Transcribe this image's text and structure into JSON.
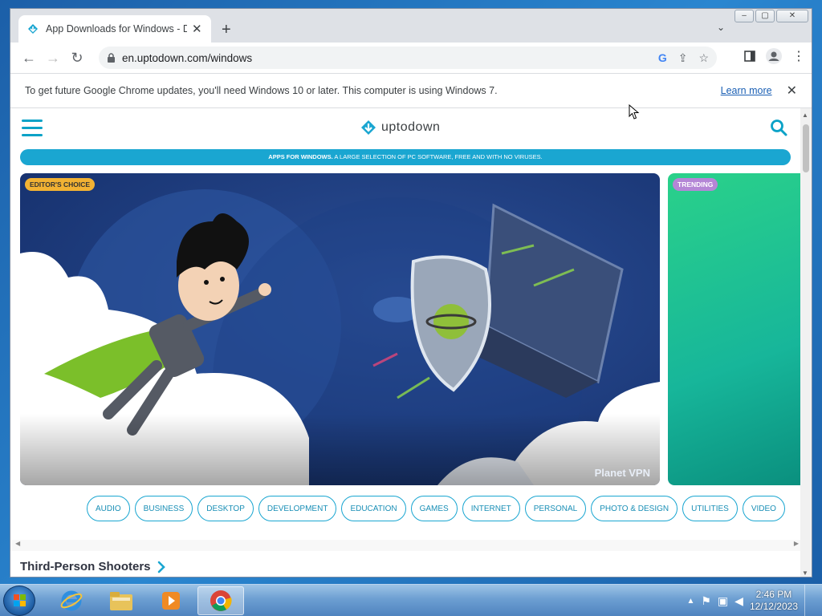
{
  "browser": {
    "tab_title": "App Downloads for Windows - D",
    "url": "en.uptodown.com/windows",
    "infobar_message": "To get future Google Chrome updates, you'll need Windows 10 or later. This computer is using Windows 7.",
    "infobar_link": "Learn more",
    "window_controls": {
      "minimize": "–",
      "restore": "▢",
      "close": "✕"
    }
  },
  "site": {
    "logo_text": "uptodown",
    "banner_bold": "APPS FOR WINDOWS.",
    "banner_text": " A LARGE SELECTION OF PC SOFTWARE, FREE AND WITH NO VIRUSES.",
    "hero_badge": "EDITOR'S CHOICE",
    "hero_caption": "Planet VPN",
    "trending_badge": "TRENDING",
    "categories": [
      "AUDIO",
      "BUSINESS",
      "DESKTOP",
      "DEVELOPMENT",
      "EDUCATION",
      "GAMES",
      "INTERNET",
      "PERSONAL",
      "PHOTO & DESIGN",
      "UTILITIES",
      "VIDEO"
    ],
    "section_title": "Third-Person Shooters"
  },
  "taskbar": {
    "time": "2:46 PM",
    "date": "12/12/2023"
  },
  "colors": {
    "accent": "#1aa6d1",
    "editor_badge": "#f2b233",
    "trend_badge": "#b486d6"
  }
}
